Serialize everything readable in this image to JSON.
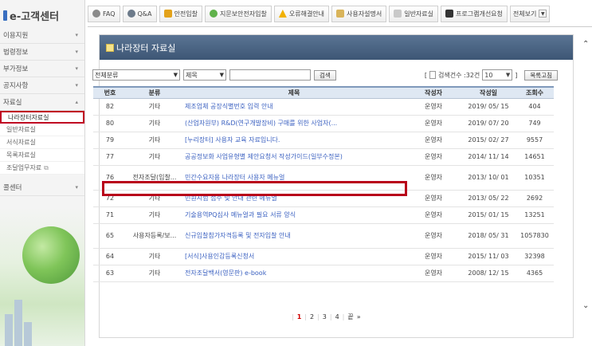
{
  "brand": {
    "title": "e-고객센터"
  },
  "sidebar": {
    "items": [
      {
        "label": "이용지원"
      },
      {
        "label": "법령정보"
      },
      {
        "label": "부가정보"
      },
      {
        "label": "공지사항"
      },
      {
        "label": "자료실"
      }
    ],
    "sub_items": [
      {
        "label": "나라장터자료실"
      },
      {
        "label": "일반자료실"
      },
      {
        "label": "서식자료실"
      },
      {
        "label": "목록자료실"
      },
      {
        "label": "조달업무자료"
      }
    ],
    "bottom_item": {
      "label": "콜센터"
    }
  },
  "tabs": [
    {
      "label": "FAQ",
      "icon": "gear-icon"
    },
    {
      "label": "Q&A",
      "icon": "refresh-icon"
    },
    {
      "label": "안전입찰",
      "icon": "lock-icon"
    },
    {
      "label": "지문보안전자입찰",
      "icon": "fingerprint-icon"
    },
    {
      "label": "오류해결안내",
      "icon": "warning-icon"
    },
    {
      "label": "사용자설명서",
      "icon": "manual-icon"
    },
    {
      "label": "일반자료실",
      "icon": "folder-icon"
    },
    {
      "label": "프로그램개선요청",
      "icon": "monitor-icon"
    },
    {
      "label": "전체보기"
    }
  ],
  "panel": {
    "title": "나라장터 자료실"
  },
  "search": {
    "category_value": "전체분류",
    "field_value": "제목",
    "query": "",
    "search_label": "검색",
    "count_text": "검색건수 :32건",
    "page_size_value": "10",
    "list_label": "목록고침"
  },
  "table": {
    "headers": [
      "번호",
      "분류",
      "제목",
      "작성자",
      "작성일",
      "조회수"
    ],
    "rows": [
      {
        "no": "82",
        "cat": "기타",
        "title": "제조업체 공장식별번호 입력 안내",
        "author": "운영자",
        "date": "2019/ 05/ 15",
        "views": "404"
      },
      {
        "no": "80",
        "cat": "기타",
        "title": "(산업자원부) R&D(연구개발장비) 구매를 위한 사업자(...",
        "author": "운영자",
        "date": "2019/ 07/ 20",
        "views": "749"
      },
      {
        "no": "79",
        "cat": "기타",
        "title": "[누리장터] 사용자 교육 자료입니다.",
        "author": "운영자",
        "date": "2015/ 02/ 27",
        "views": "9557"
      },
      {
        "no": "77",
        "cat": "기타",
        "title": "공공정보화 사업유형별 제안요청서 작성가이드(일부수정본)",
        "author": "운영자",
        "date": "2014/ 11/ 14",
        "views": "14651"
      },
      {
        "no": "76",
        "cat": "전자조달(입찰...",
        "title": "민간수요자용 나라장터 사용자 메뉴얼",
        "author": "운영자",
        "date": "2013/ 10/ 01",
        "views": "10351"
      },
      {
        "no": "72",
        "cat": "기타",
        "title": "민원시험 접수 및 안내 관련 메뉴얼",
        "author": "운영자",
        "date": "2013/ 05/ 22",
        "views": "2692"
      },
      {
        "no": "71",
        "cat": "기타",
        "title": "기술용역PQ심사 메뉴얼과 필요 서류 양식",
        "author": "운영자",
        "date": "2015/ 01/ 15",
        "views": "13251"
      },
      {
        "no": "65",
        "cat": "사용자등록/보...",
        "title": "신규입찰참가자격등록 및 전자입찰 안내",
        "author": "운영자",
        "date": "2018/ 05/ 31",
        "views": "1057830"
      },
      {
        "no": "64",
        "cat": "기타",
        "title": "[서식]사용인감등록신청서",
        "author": "운영자",
        "date": "2015/ 11/ 03",
        "views": "32398"
      },
      {
        "no": "63",
        "cat": "기타",
        "title": "전자조달백서(영문판) e-book",
        "author": "운영자",
        "date": "2008/ 12/ 15",
        "views": "4365"
      }
    ]
  },
  "pager": {
    "pages": [
      "1",
      "2",
      "3",
      "4"
    ],
    "last_label": "끝",
    "next_symbol": "»"
  }
}
